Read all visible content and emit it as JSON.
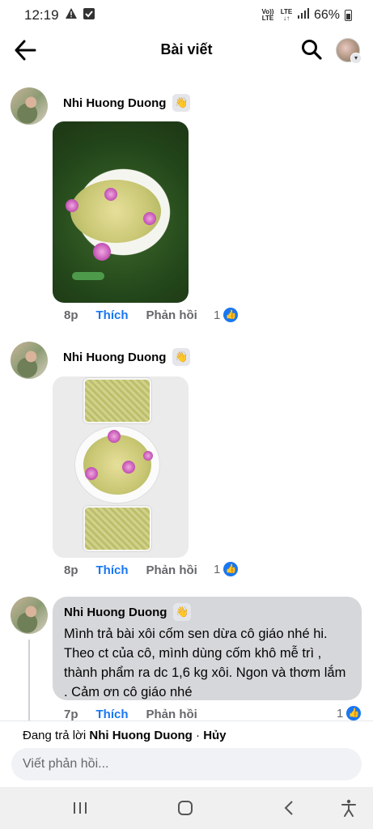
{
  "status_bar": {
    "time": "12:19",
    "net1": "Vo)) LTE",
    "net2": "LTE ↓↑",
    "battery": "66%"
  },
  "header": {
    "title": "Bài viết"
  },
  "comments": [
    {
      "author": "Nhi Huong Duong",
      "time": "8p",
      "like_label": "Thích",
      "reply_label": "Phản hồi",
      "reaction_count": "1"
    },
    {
      "author": "Nhi Huong Duong",
      "time": "8p",
      "like_label": "Thích",
      "reply_label": "Phản hồi",
      "reaction_count": "1"
    },
    {
      "author": "Nhi Huong Duong",
      "text": "Mình trả bài xôi cốm sen dừa cô giáo nhé hi. Theo ct của cô, mình dùng cốm khô mễ trì , thành phẩm ra dc 1,6 kg xôi. Ngon và thơm lắm . Cảm ơn cô giáo nhé",
      "time": "7p",
      "like_label": "Thích",
      "reply_label": "Phản hồi",
      "reaction_count": "1"
    }
  ],
  "reply_bar": {
    "prefix": "Đang trả lời",
    "name": "Nhi Huong Duong",
    "separator": "·",
    "cancel": "Hủy",
    "placeholder": "Viết phản hồi..."
  },
  "colors": {
    "accent": "#1877f2",
    "muted": "#65676b",
    "bubble": "#d6d7da"
  }
}
